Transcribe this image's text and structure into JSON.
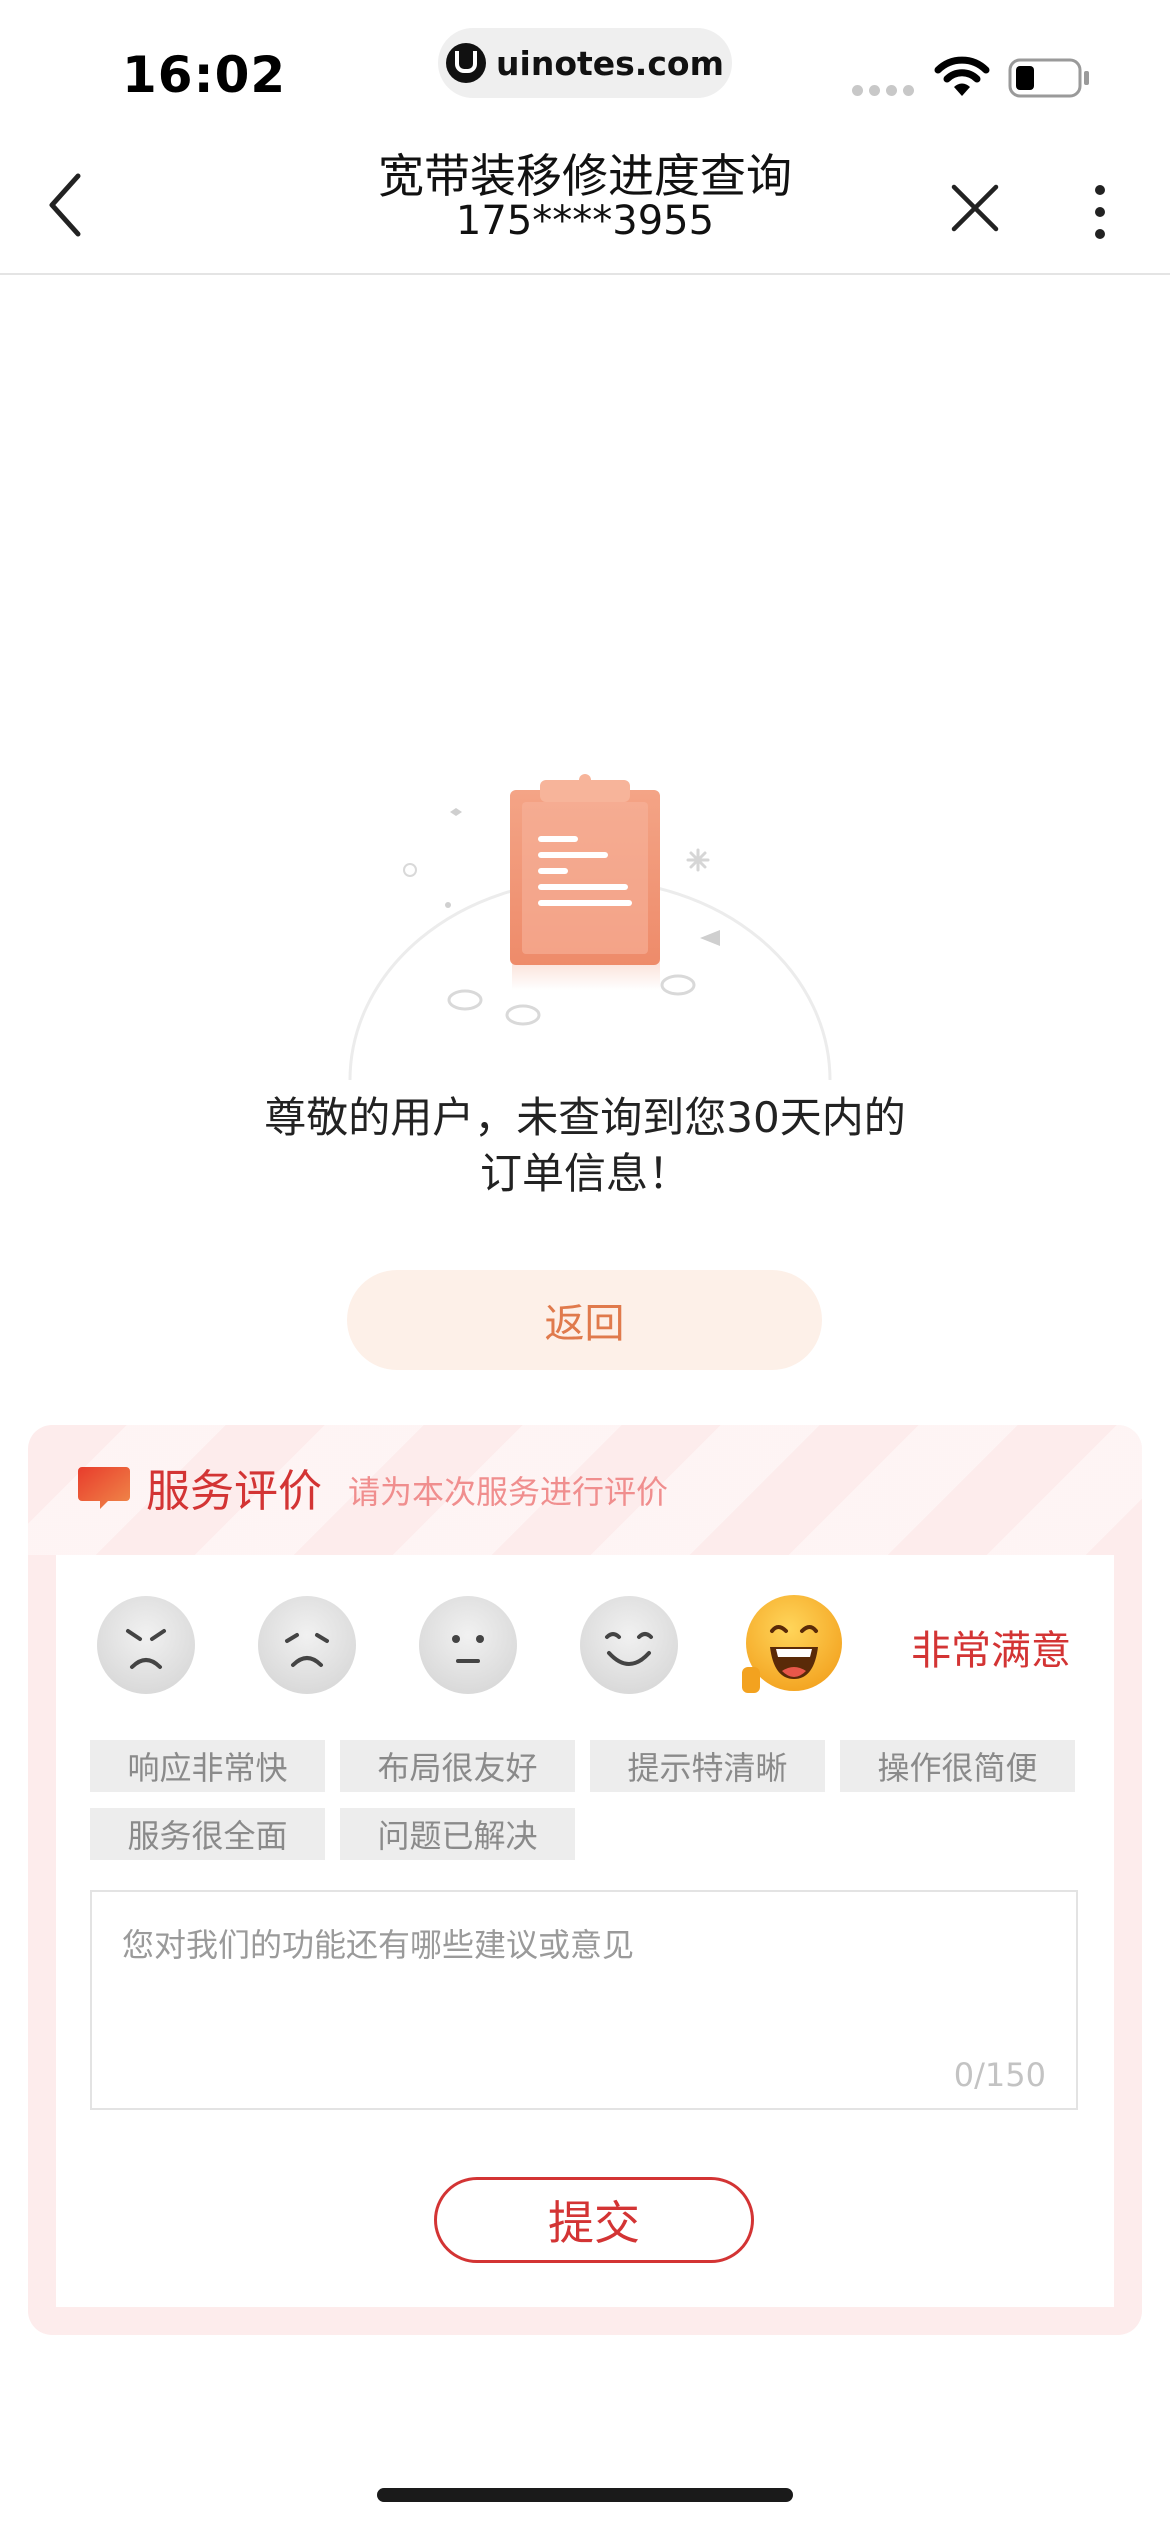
{
  "status_bar": {
    "time": "16:02",
    "url": "uinotes.com"
  },
  "nav": {
    "title": "宽带装移修进度查询",
    "subtitle": "175****3955",
    "icons": {
      "back": "chevron-left-icon",
      "close": "close-icon",
      "more": "more-vertical-icon"
    }
  },
  "empty_state": {
    "illustration": "clipboard-illustration",
    "message_line1": "尊敬的用户，未查询到您30天内的",
    "message_line2": "订单信息！",
    "return_label": "返回"
  },
  "rating": {
    "title": "服务评价",
    "subtitle": "请为本次服务进行评价",
    "faces": [
      {
        "name": "angry-face-icon",
        "selected": false
      },
      {
        "name": "sad-face-icon",
        "selected": false
      },
      {
        "name": "neutral-face-icon",
        "selected": false
      },
      {
        "name": "smile-face-icon",
        "selected": false
      },
      {
        "name": "laughing-face-icon",
        "selected": true
      }
    ],
    "selected_label": "非常满意",
    "tags": [
      "响应非常快",
      "布局很友好",
      "提示特清晰",
      "操作很简便",
      "服务很全面",
      "问题已解决"
    ],
    "feedback_placeholder": "您对我们的功能还有哪些建议或意见",
    "char_count": "0/150",
    "submit_label": "提交"
  },
  "colors": {
    "accent_red": "#d33434",
    "orange": "#e07a4c",
    "card_bg": "#fdecec"
  }
}
